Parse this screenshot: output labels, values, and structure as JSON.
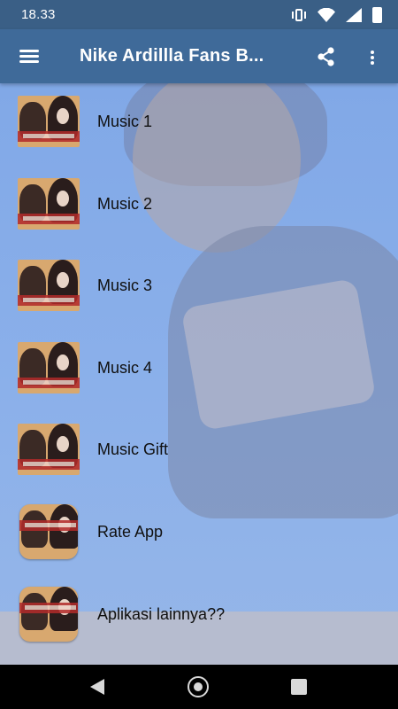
{
  "status": {
    "time": "18.33",
    "icons": [
      "vibrate-icon",
      "wifi-icon",
      "signal-icon",
      "battery-icon"
    ]
  },
  "appbar": {
    "title": "Nike Ardillla Fans B...",
    "menu_icon": "hamburger-menu-icon",
    "share_icon": "share-icon",
    "more_icon": "more-vert-icon"
  },
  "list": {
    "items": [
      {
        "label": "Music 1",
        "icon": "album-thumbnail"
      },
      {
        "label": "Music 2",
        "icon": "album-thumbnail"
      },
      {
        "label": "Music 3",
        "icon": "album-thumbnail"
      },
      {
        "label": "Music 4",
        "icon": "album-thumbnail"
      },
      {
        "label": "Music Gift",
        "icon": "album-thumbnail"
      },
      {
        "label": "Rate App",
        "icon": "app-icon-thumbnail"
      },
      {
        "label": "Aplikasi lainnya??",
        "icon": "app-icon-thumbnail"
      }
    ]
  },
  "navbar": {
    "back_icon": "back-triangle-icon",
    "home_icon": "home-circle-icon",
    "recents_icon": "recents-square-icon"
  }
}
